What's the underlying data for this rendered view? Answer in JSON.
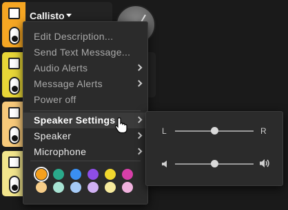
{
  "device": {
    "name": "Callisto",
    "strip_colors": [
      "#f5a623",
      "#e8d637",
      "#f7c97a",
      "#f2e58c"
    ]
  },
  "menu": {
    "items": [
      {
        "label": "Edit Description...",
        "has_submenu": false,
        "state": "disabled"
      },
      {
        "label": "Send Text Message...",
        "has_submenu": false,
        "state": "disabled"
      },
      {
        "label": "Audio Alerts",
        "has_submenu": true,
        "state": "disabled"
      },
      {
        "label": "Message Alerts",
        "has_submenu": true,
        "state": "disabled"
      },
      {
        "label": "Power off",
        "has_submenu": false,
        "state": "disabled"
      },
      {
        "label": "Speaker Settings",
        "has_submenu": true,
        "state": "hover"
      },
      {
        "label": "Speaker",
        "has_submenu": true,
        "state": "normal"
      },
      {
        "label": "Microphone",
        "has_submenu": true,
        "state": "normal"
      }
    ],
    "swatch_rows": [
      [
        "#f5a01d",
        "#2aa98a",
        "#3a8ff2",
        "#8d4de6",
        "#f0d72e",
        "#d63fa8"
      ],
      [
        "#f7cd88",
        "#a8e3d3",
        "#a6cbf7",
        "#d0b0f2",
        "#f6ea9c",
        "#f0b2de"
      ]
    ],
    "selected_swatch": 0
  },
  "submenu": {
    "balance": {
      "left_label": "L",
      "right_label": "R",
      "value": 0.5
    },
    "volume": {
      "value": 0.5
    }
  },
  "icons": {
    "chevron": "chevron-right-icon",
    "speaker_low": "volume-low-icon",
    "speaker_high": "volume-high-icon",
    "cursor": "hand-pointer-icon",
    "knob": "volume-knob-icon"
  }
}
